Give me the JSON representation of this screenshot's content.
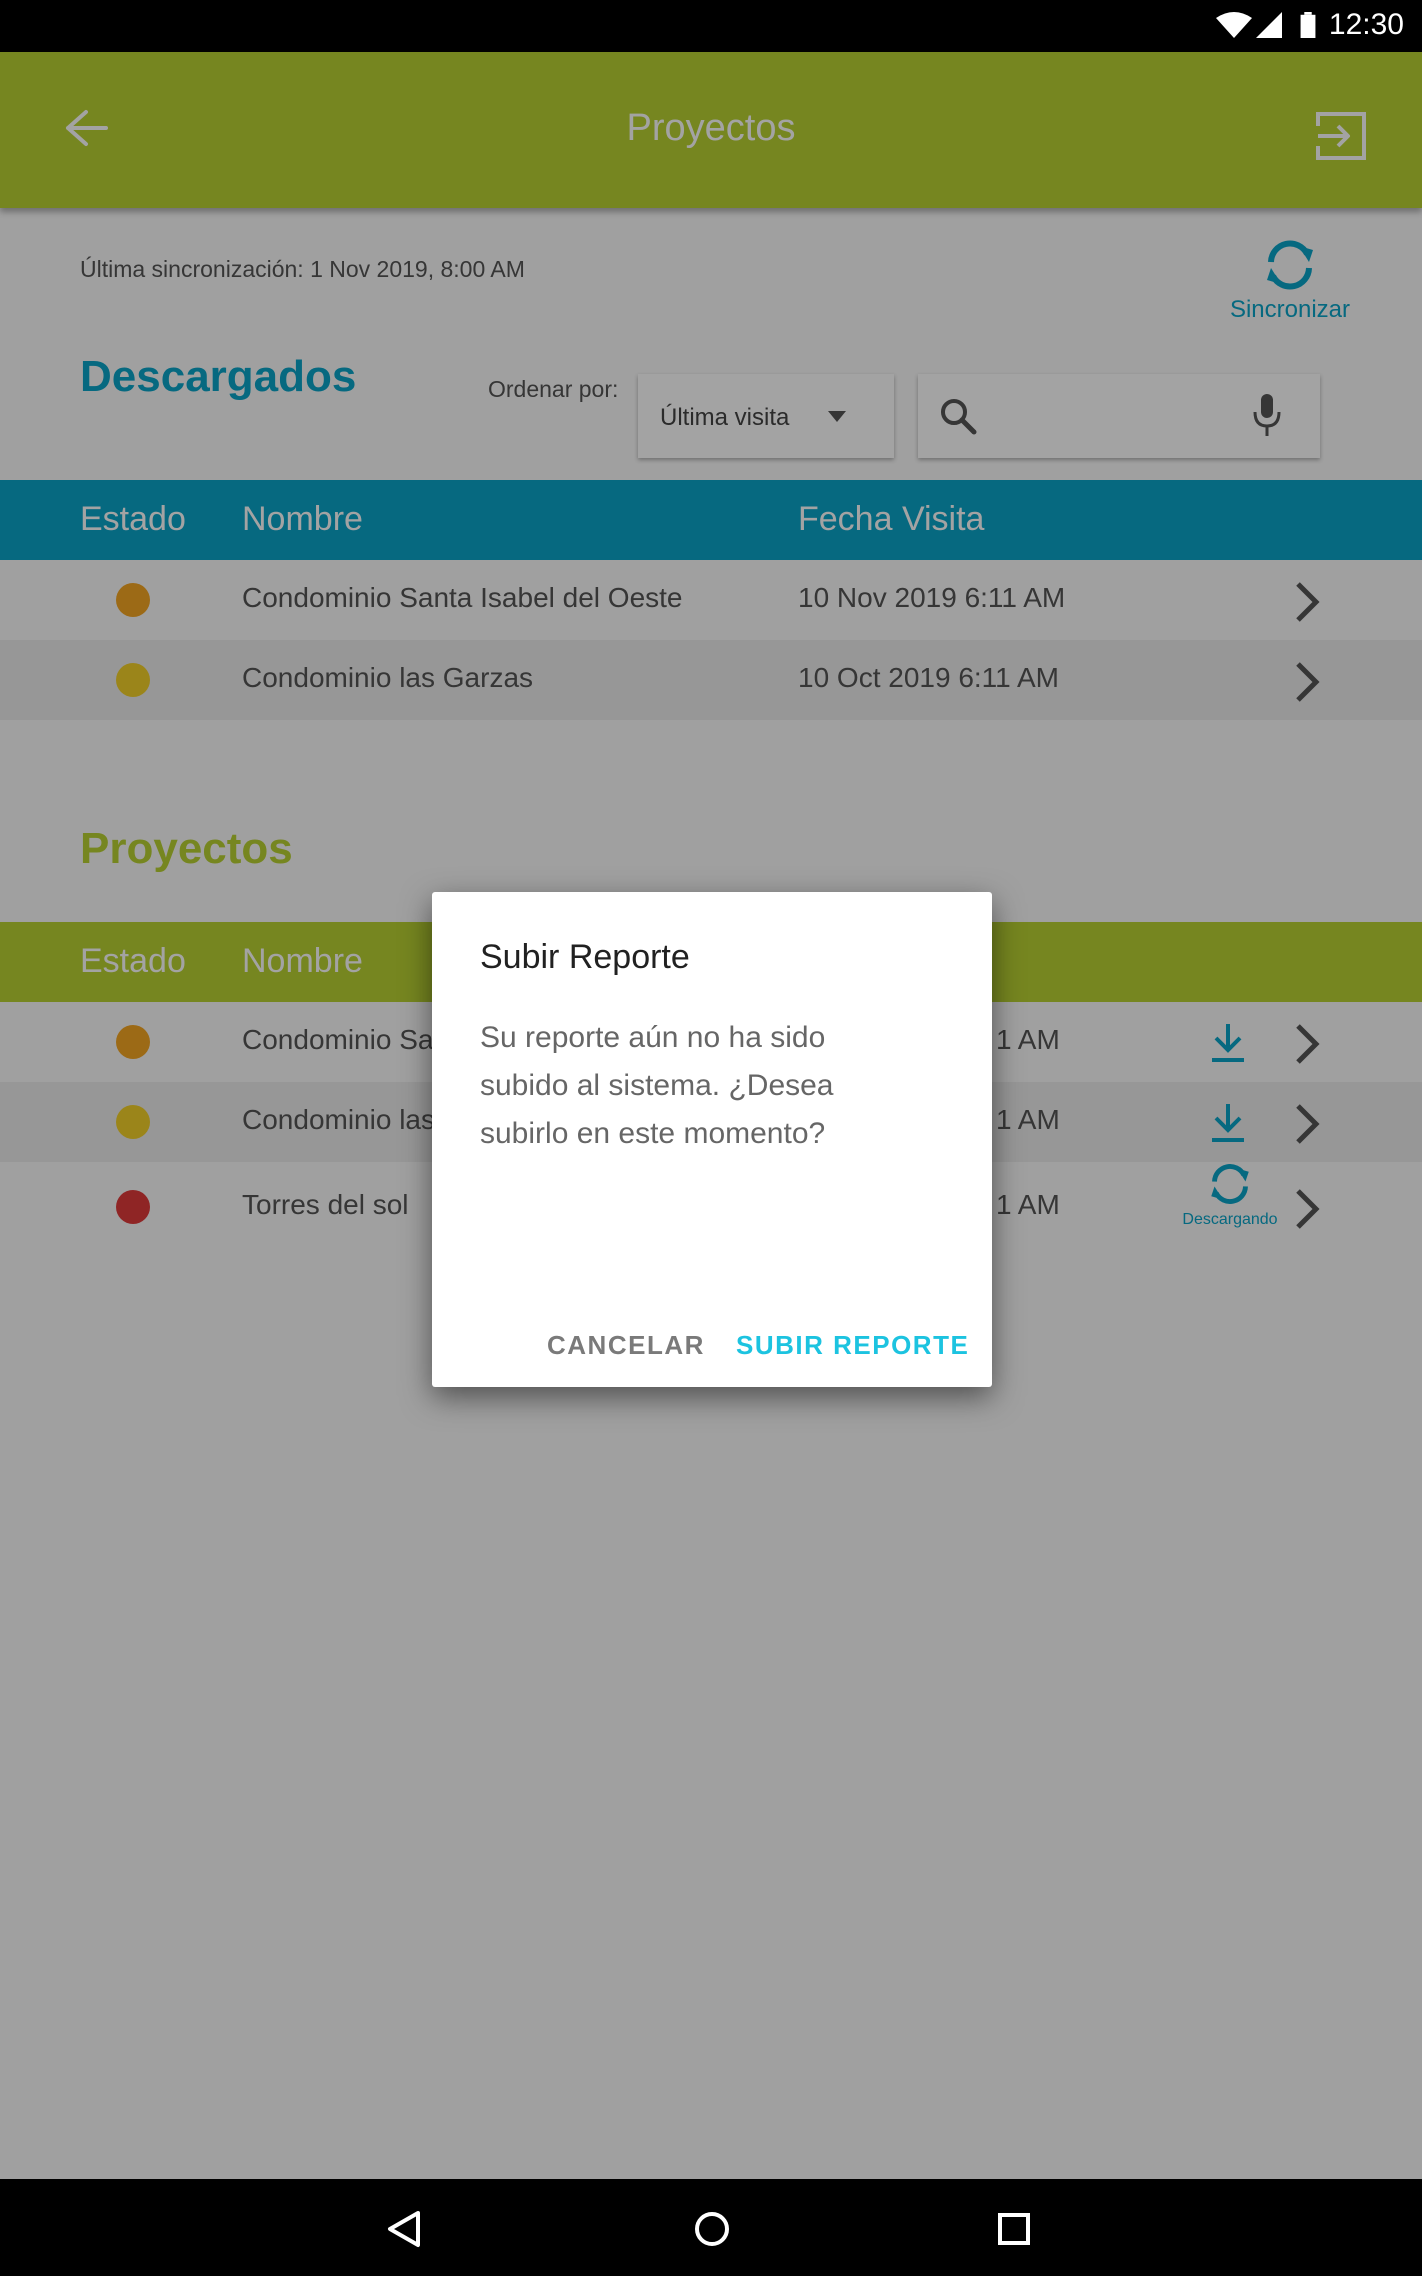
{
  "status_bar": {
    "time": "12:30"
  },
  "app_bar": {
    "title": "Proyectos"
  },
  "sync": {
    "last_sync": "Última sincronización: 1 Nov 2019, 8:00 AM",
    "label": "Sincronizar"
  },
  "downloaded": {
    "title": "Descargados",
    "order_label": "Ordenar por:",
    "order_value": "Última visita",
    "columns": [
      "Estado",
      "Nombre",
      "Fecha Visita"
    ],
    "rows": [
      {
        "name": "Condominio Santa Isabel del Oeste",
        "date": "10 Nov 2019 6:11 AM",
        "status_color": "#f5a623"
      },
      {
        "name": "Condominio las Garzas",
        "date": "10 Oct 2019 6:11 AM",
        "status_color": "#f3d02a"
      }
    ]
  },
  "projects": {
    "title": "Proyectos",
    "columns": [
      "Estado",
      "Nombre"
    ],
    "rows": [
      {
        "name": "Condominio Sa",
        "date": "1 AM",
        "status_color": "#f5a623",
        "action": "download-icon"
      },
      {
        "name": "Condominio las",
        "date": "1 AM",
        "status_color": "#f3d02a",
        "action": "download-icon"
      },
      {
        "name": "Torres del sol",
        "date": "1 AM",
        "status_color": "#e03b3b",
        "action": "sync-icon",
        "action_label": "Descargando"
      }
    ]
  },
  "dialog": {
    "title": "Subir Reporte",
    "body": "Su reporte aún no ha sido subido al sistema. ¿Desea subirlo en este momento?",
    "cancel": "CANCELAR",
    "confirm": "SUBIR REPORTE"
  },
  "colors": {
    "primary_green": "#b9d232",
    "accent_blue": "#0aa4c8",
    "dialog_action": "#1cc3e0"
  }
}
